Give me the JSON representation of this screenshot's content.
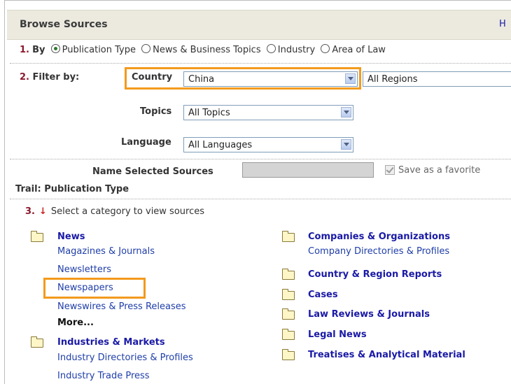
{
  "header": {
    "title": "Browse Sources",
    "help": "H"
  },
  "by": {
    "number": "1.",
    "label": "By",
    "options": [
      "Publication Type",
      "News & Business Topics",
      "Industry",
      "Area of Law"
    ],
    "selected": "Publication Type"
  },
  "filter": {
    "number": "2.",
    "label": "Filter by:",
    "country_label": "Country",
    "country_value": "China",
    "region_value": "All Regions",
    "topics_label": "Topics",
    "topics_value": "All Topics",
    "language_label": "Language",
    "language_value": "All Languages"
  },
  "name_sources": {
    "label": "Name Selected Sources",
    "value": "",
    "favorite_label": "Save as a favorite"
  },
  "trail": "Trail: Publication Type",
  "step3": {
    "number": "3.",
    "text": "Select a category to view sources"
  },
  "left_categories": {
    "news": "News",
    "news_items": [
      "Magazines & Journals",
      "Newsletters",
      "Newspapers",
      "Newswires & Press Releases"
    ],
    "news_more": "More...",
    "industries": "Industries & Markets",
    "industries_items": [
      "Industry Directories & Profiles",
      "Industry Trade Press"
    ]
  },
  "right_categories": {
    "companies": "Companies & Organizations",
    "companies_items": [
      "Company Directories & Profiles"
    ],
    "others": [
      "Country & Region Reports",
      "Cases",
      "Law Reviews & Journals",
      "Legal News",
      "Treatises & Analytical Material"
    ]
  },
  "colors": {
    "highlight": "#f39a1d",
    "header_bg": "#eceadf",
    "link": "#1f3ea8",
    "step_number": "#8b1a2e"
  }
}
